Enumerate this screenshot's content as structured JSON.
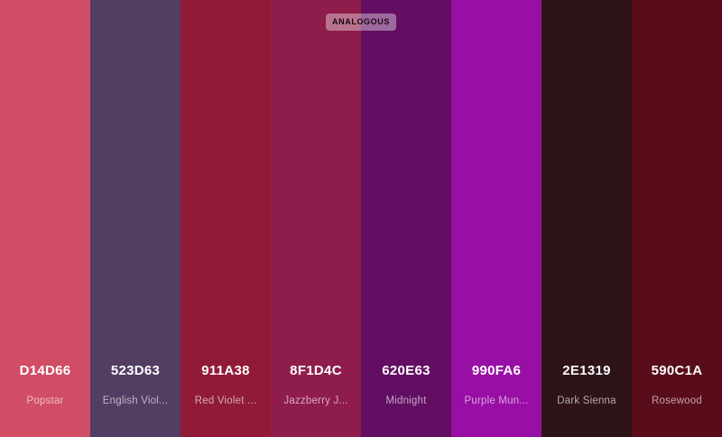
{
  "palette": {
    "scheme_label": "ANALOGOUS",
    "colors": [
      {
        "hex": "D14D66",
        "name": "Popstar",
        "color": "#D14D66"
      },
      {
        "hex": "523D63",
        "name": "English Viol...",
        "color": "#523D63"
      },
      {
        "hex": "911A38",
        "name": "Red Violet ...",
        "color": "#911A38"
      },
      {
        "hex": "8F1D4C",
        "name": "Jazzberry J...",
        "color": "#8F1D4C"
      },
      {
        "hex": "620E63",
        "name": "Midnight",
        "color": "#620E63"
      },
      {
        "hex": "990FA6",
        "name": "Purple Mun...",
        "color": "#990FA6"
      },
      {
        "hex": "2E1319",
        "name": "Dark Sienna",
        "color": "#2E1319"
      },
      {
        "hex": "590C1A",
        "name": "Rosewood",
        "color": "#590C1A"
      }
    ]
  }
}
